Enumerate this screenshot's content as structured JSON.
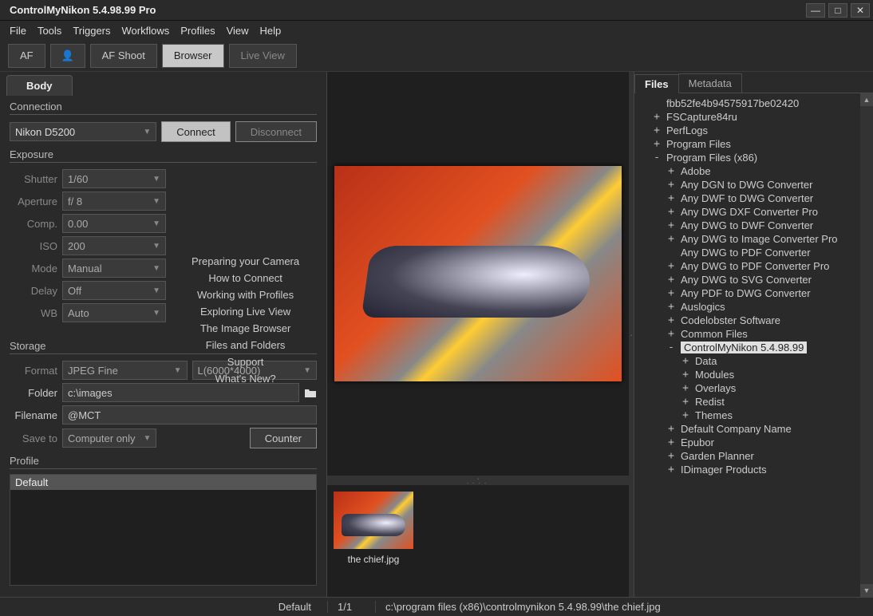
{
  "window": {
    "title": "ControlMyNikon 5.4.98.99 Pro"
  },
  "menu": [
    "File",
    "Tools",
    "Triggers",
    "Workflows",
    "Profiles",
    "View",
    "Help"
  ],
  "toolbar": {
    "af": "AF",
    "afshoot": "AF Shoot",
    "browser": "Browser",
    "liveview": "Live View"
  },
  "left": {
    "tab": "Body",
    "connection": {
      "label": "Connection",
      "camera": "Nikon D5200",
      "connect": "Connect",
      "disconnect": "Disconnect"
    },
    "exposure": {
      "label": "Exposure",
      "shutter_l": "Shutter",
      "shutter_v": "1/60",
      "aperture_l": "Aperture",
      "aperture_v": "f/ 8",
      "comp_l": "Comp.",
      "comp_v": "0.00",
      "iso_l": "ISO",
      "iso_v": "200",
      "mode_l": "Mode",
      "mode_v": "Manual",
      "delay_l": "Delay",
      "delay_v": "Off",
      "wb_l": "WB",
      "wb_v": "Auto"
    },
    "help": [
      "Preparing your Camera",
      "How to Connect",
      "Working with Profiles",
      "Exploring Live View",
      "The Image Browser",
      "Files and Folders",
      "Support",
      "What's New?"
    ],
    "storage": {
      "label": "Storage",
      "format_l": "Format",
      "format_v": "JPEG Fine",
      "size_v": "L(6000*4000)",
      "folder_l": "Folder",
      "folder_v": "c:\\images",
      "filename_l": "Filename",
      "filename_v": "@MCT",
      "saveto_l": "Save to",
      "saveto_v": "Computer only",
      "counter": "Counter"
    },
    "profile": {
      "label": "Profile",
      "items": [
        "Default"
      ]
    }
  },
  "right": {
    "tabs": {
      "files": "Files",
      "metadata": "Metadata"
    },
    "tree": [
      {
        "d": 1,
        "e": "",
        "t": "fbb52fe4b94575917be02420"
      },
      {
        "d": 1,
        "e": "+",
        "t": "FSCapture84ru"
      },
      {
        "d": 1,
        "e": "+",
        "t": "PerfLogs"
      },
      {
        "d": 1,
        "e": "+",
        "t": "Program Files"
      },
      {
        "d": 1,
        "e": "-",
        "t": "Program Files (x86)"
      },
      {
        "d": 2,
        "e": "+",
        "t": "Adobe"
      },
      {
        "d": 2,
        "e": "+",
        "t": "Any DGN to DWG Converter"
      },
      {
        "d": 2,
        "e": "+",
        "t": "Any DWF to DWG Converter"
      },
      {
        "d": 2,
        "e": "+",
        "t": "Any DWG DXF Converter Pro"
      },
      {
        "d": 2,
        "e": "+",
        "t": "Any DWG to DWF Converter"
      },
      {
        "d": 2,
        "e": "+",
        "t": "Any DWG to Image Converter Pro"
      },
      {
        "d": 2,
        "e": "",
        "t": "Any DWG to PDF Converter"
      },
      {
        "d": 2,
        "e": "+",
        "t": "Any DWG to PDF Converter Pro"
      },
      {
        "d": 2,
        "e": "+",
        "t": "Any DWG to SVG Converter"
      },
      {
        "d": 2,
        "e": "+",
        "t": "Any PDF to DWG Converter"
      },
      {
        "d": 2,
        "e": "+",
        "t": "Auslogics"
      },
      {
        "d": 2,
        "e": "+",
        "t": "Codelobster Software"
      },
      {
        "d": 2,
        "e": "+",
        "t": "Common Files"
      },
      {
        "d": 2,
        "e": "-",
        "t": "ControlMyNikon 5.4.98.99",
        "sel": true
      },
      {
        "d": 3,
        "e": "+",
        "t": "Data"
      },
      {
        "d": 3,
        "e": "+",
        "t": "Modules"
      },
      {
        "d": 3,
        "e": "+",
        "t": "Overlays"
      },
      {
        "d": 3,
        "e": "+",
        "t": "Redist"
      },
      {
        "d": 3,
        "e": "+",
        "t": "Themes"
      },
      {
        "d": 2,
        "e": "+",
        "t": "Default Company Name"
      },
      {
        "d": 2,
        "e": "+",
        "t": "Epubor"
      },
      {
        "d": 2,
        "e": "+",
        "t": "Garden Planner"
      },
      {
        "d": 2,
        "e": "+",
        "t": "IDimager Products"
      }
    ]
  },
  "thumb": {
    "caption": "the chief.jpg"
  },
  "status": {
    "profile": "Default",
    "count": "1/1",
    "path": "c:\\program files (x86)\\controlmynikon 5.4.98.99\\the chief.jpg"
  }
}
